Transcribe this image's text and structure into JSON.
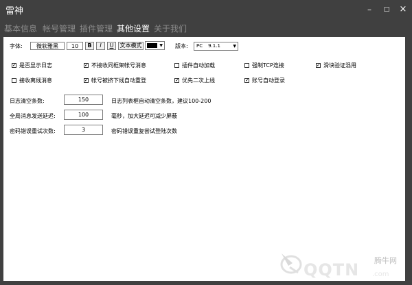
{
  "window": {
    "title": "雷神",
    "min_glyph": "–",
    "max_glyph": "□",
    "close_glyph": "×"
  },
  "tabs": [
    {
      "label": "基本信息",
      "active": false
    },
    {
      "label": "帐号管理",
      "active": false
    },
    {
      "label": "插件管理",
      "active": false
    },
    {
      "label": "其他设置",
      "active": true
    },
    {
      "label": "关于我们",
      "active": false
    }
  ],
  "font_row": {
    "label": "字体:",
    "font_name": "微软雅黑",
    "font_size": "10",
    "bold": "B",
    "italic": "I",
    "underline": "U",
    "text_mode": "文本模式",
    "color": "#000000"
  },
  "version": {
    "label": "版本:",
    "platform": "PC",
    "number": "9.1.1"
  },
  "options_row1": [
    {
      "label": "是否显示日志",
      "checked": true
    },
    {
      "label": "不接收同框架帐号消息",
      "checked": true
    },
    {
      "label": "插件自动加载",
      "checked": false
    },
    {
      "label": "强制TCP连接",
      "checked": false
    },
    {
      "label": "滑块验证混用",
      "checked": true
    }
  ],
  "options_row2": [
    {
      "label": "接收离线消息",
      "checked": false
    },
    {
      "label": "帐号被挤下线自动重登",
      "checked": true
    },
    {
      "label": "优先二次上线",
      "checked": true
    },
    {
      "label": "账号自动登录",
      "checked": true
    }
  ],
  "settings": [
    {
      "label": "日志清空条数:",
      "value": "150",
      "hint": "日志列表框自动清空条数，建议100-200"
    },
    {
      "label": "全局消息发送延迟:",
      "value": "100",
      "hint": "毫秒，加大延迟可减少屏蔽"
    },
    {
      "label": "密码错误重试次数:",
      "value": "3",
      "hint": "密码错误重复尝试登陆次数"
    }
  ],
  "watermark": {
    "logo": "QQTN",
    "domain": ".com",
    "site_name": "腾牛网"
  },
  "icons": {
    "dropdown": "▼",
    "check": "✓"
  },
  "colors": {
    "window_bg": "#404040",
    "panel_bg": "#ffffff",
    "tab_active": "#ffffff",
    "tab_inactive": "#8c8c8c"
  }
}
